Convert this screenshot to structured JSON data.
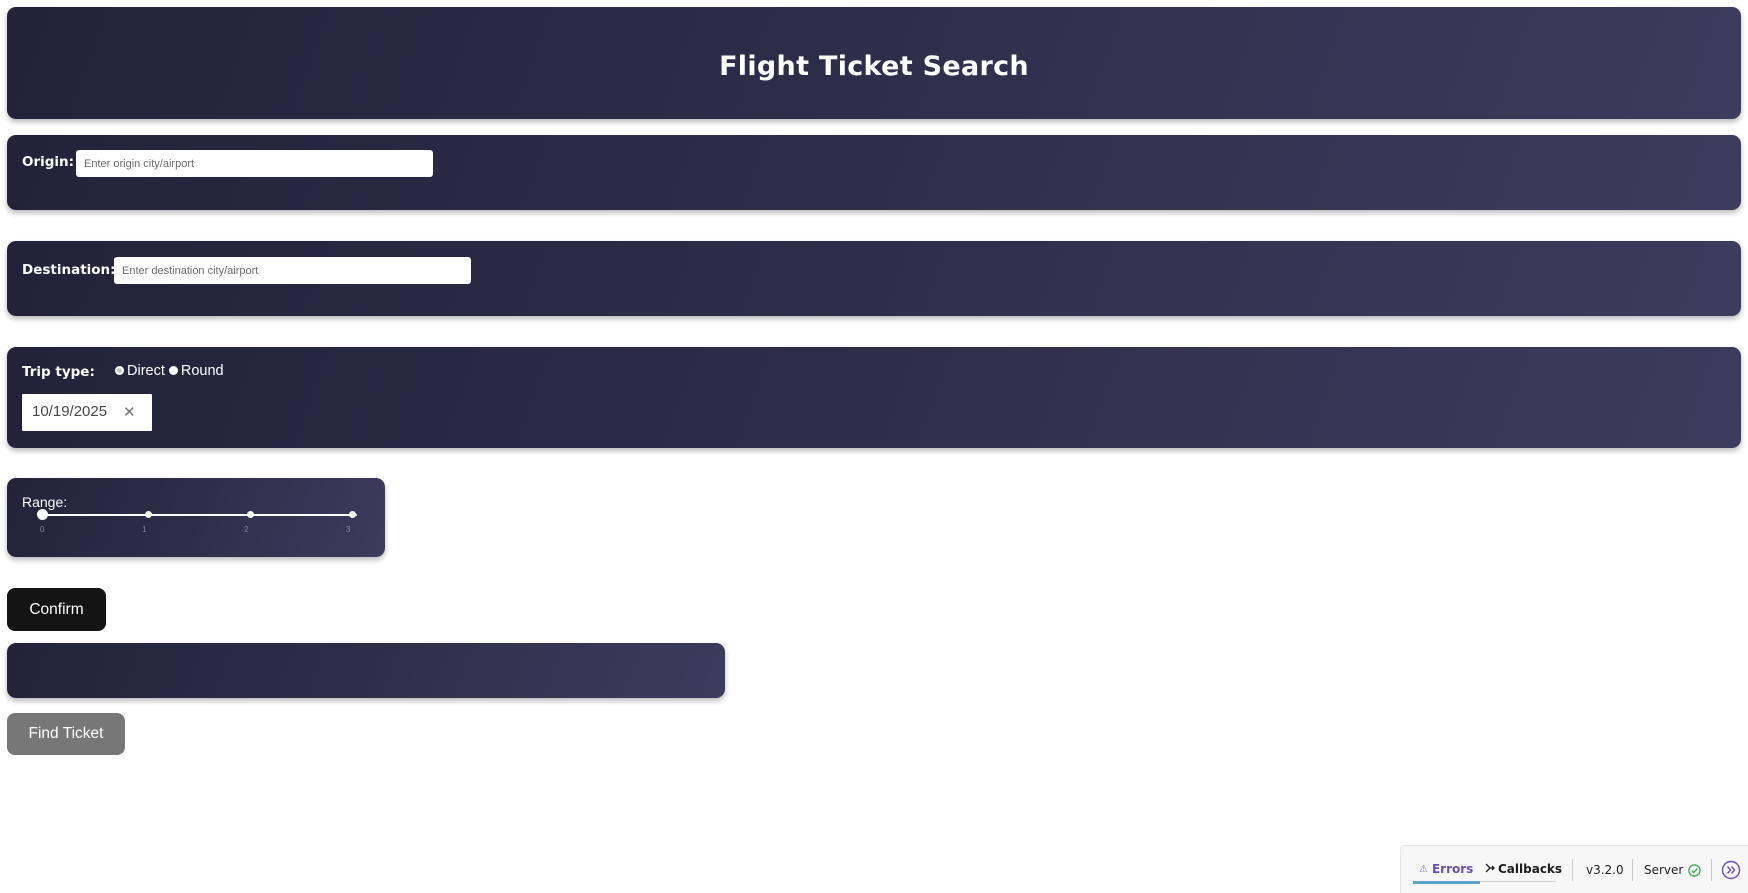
{
  "header": {
    "title": "Flight Ticket Search"
  },
  "origin": {
    "label": "Origin:",
    "placeholder": "Enter origin city/airport",
    "value": ""
  },
  "destination": {
    "label": "Destination:",
    "placeholder": "Enter destination city/airport",
    "value": ""
  },
  "trip": {
    "label": "Trip type:",
    "options": [
      {
        "label": "Direct",
        "checked": true
      },
      {
        "label": "Round",
        "checked": false
      }
    ],
    "date": "10/19/2025",
    "clear_icon": "close-icon"
  },
  "range": {
    "label": "Range:",
    "ticks": [
      "0",
      "1",
      "2",
      "3"
    ],
    "value": 0,
    "min": 0,
    "max": 3
  },
  "buttons": {
    "confirm": "Confirm",
    "find": "Find Ticket"
  },
  "result": {
    "text": ""
  },
  "devtools": {
    "errors": "Errors",
    "callbacks": "Callbacks",
    "version": "v3.2.0",
    "server": "Server",
    "errors_icon": "warning-icon",
    "callbacks_icon": "callbacks-icon",
    "server_icon": "check-circle-icon",
    "expand_icon": "double-chevron-right-icon",
    "accent_color": "#6a4fb3",
    "ok_color": "#3aa655"
  }
}
